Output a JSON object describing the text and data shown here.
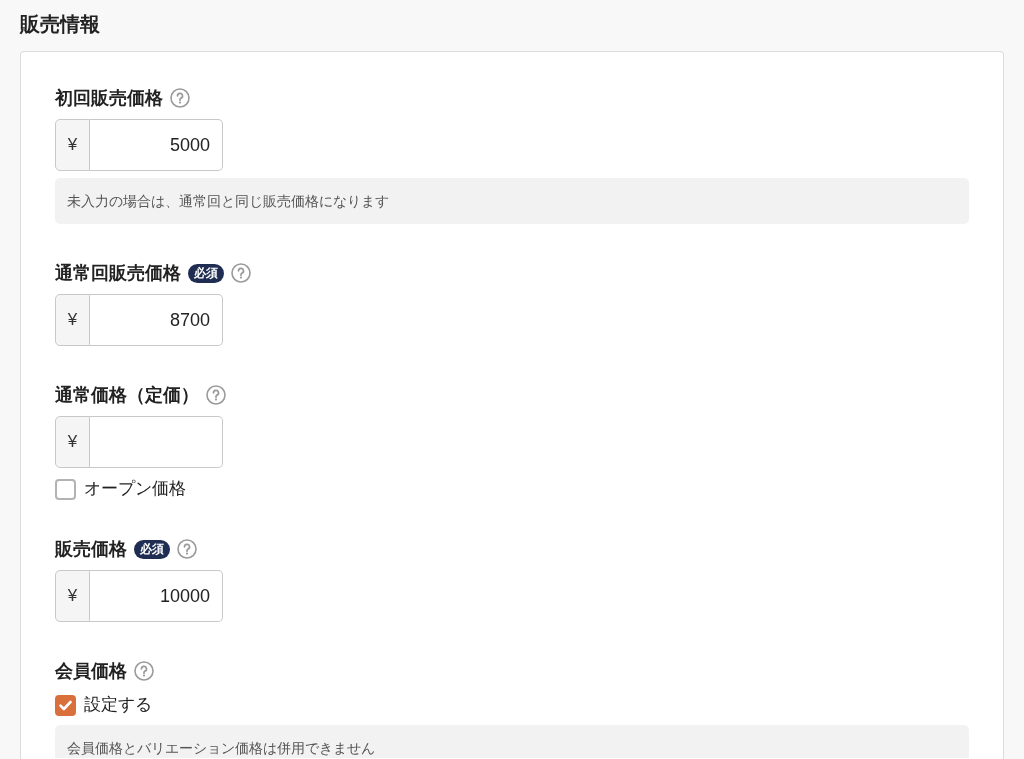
{
  "section": {
    "title": "販売情報"
  },
  "fields": [
    {
      "label": "初回販売価格",
      "input": {
        "prefix": "¥",
        "value": "5000"
      },
      "note": "未入力の場合は、通常回と同じ販売価格になります"
    },
    {
      "label": "通常回販売価格",
      "badge": "必須",
      "input": {
        "prefix": "¥",
        "value": "8700"
      }
    },
    {
      "label": "通常価格（定価）",
      "input": {
        "prefix": "¥"
      },
      "checkbox": {
        "label": "オープン価格",
        "checked": false
      }
    },
    {
      "label": "販売価格",
      "badge": "必須",
      "input": {
        "prefix": "¥",
        "value": "10000"
      }
    },
    {
      "label": "会員価格",
      "checkbox": {
        "label": "設定する",
        "checked": true
      },
      "note": "会員価格とバリエーション価格は併用できません"
    }
  ]
}
